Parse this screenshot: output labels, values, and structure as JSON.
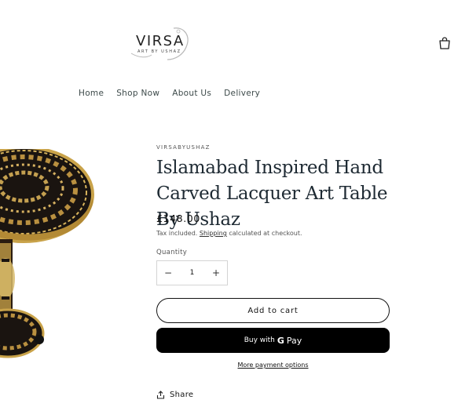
{
  "header": {
    "logo_text": "VIRSA",
    "logo_sub": "ART BY USHAZ",
    "cart_icon": "cart-icon"
  },
  "nav": {
    "items": [
      {
        "label": "Home"
      },
      {
        "label": "Shop Now"
      },
      {
        "label": "About Us"
      },
      {
        "label": "Delivery"
      }
    ]
  },
  "product": {
    "vendor": "VIRSABYUSHAZ",
    "title": "Islamabad Inspired Hand Carved Lacquer Art Table By Ushaz",
    "price": "£148.00",
    "tax_prefix": "Tax included.",
    "shipping_link": "Shipping",
    "tax_suffix": "calculated at checkout.",
    "quantity_label": "Quantity",
    "quantity_value": "1",
    "decrease_symbol": "−",
    "increase_symbol": "+",
    "add_to_cart": "Add to cart",
    "buy_with": "Buy with",
    "gpay_g": "G",
    "gpay_pay": "Pay",
    "more_payment": "More payment options",
    "share": "Share"
  },
  "colors": {
    "title": "#1e2a33",
    "button_dark": "#000000",
    "table_gold": "#c9a34a",
    "table_dark": "#1a1410"
  }
}
